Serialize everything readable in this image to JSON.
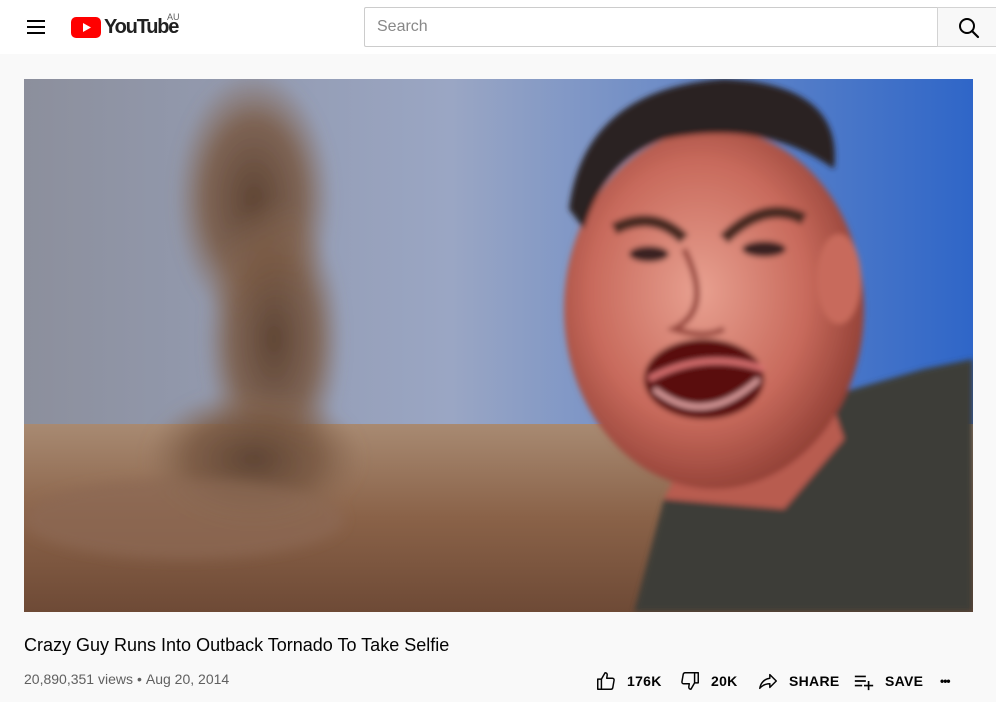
{
  "header": {
    "logo_text": "YouTube",
    "region": "AU",
    "search_placeholder": "Search"
  },
  "video": {
    "title": "Crazy Guy Runs Into Outback Tornado To Take Selfie",
    "views": "20,890,351 views",
    "separator": "•",
    "date": "Aug 20, 2014"
  },
  "actions": {
    "likes": "176K",
    "dislikes": "20K",
    "share": "SHARE",
    "save": "SAVE",
    "more": "•••"
  },
  "colors": {
    "youtube_red": "#ff0000",
    "text_primary": "#030303",
    "text_secondary": "#606060"
  }
}
